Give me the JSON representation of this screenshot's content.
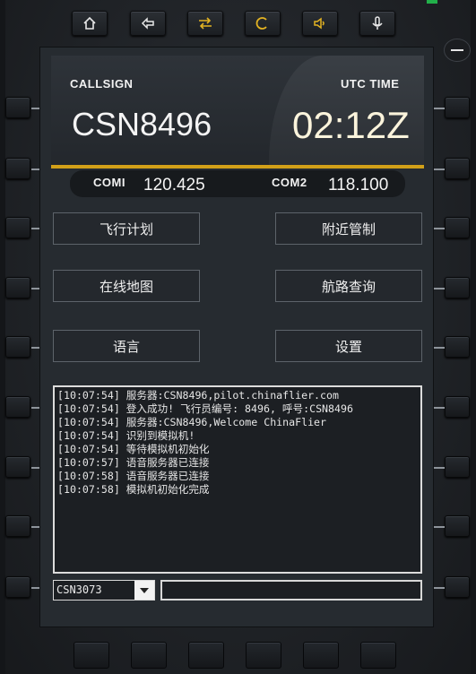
{
  "colors": {
    "accent_gold": "#d2a018",
    "status_green": "#22b04a"
  },
  "toolbar": {
    "keys": [
      {
        "name": "home-key",
        "icon": "home-icon"
      },
      {
        "name": "back-key",
        "icon": "back-arrow-icon"
      },
      {
        "name": "swap-key",
        "icon": "swap-arrows-icon"
      },
      {
        "name": "c-key",
        "icon": "c-icon"
      },
      {
        "name": "speaker-key",
        "icon": "speaker-icon"
      },
      {
        "name": "mic-key",
        "icon": "microphone-icon"
      }
    ]
  },
  "header": {
    "callsign_label": "CALLSIGN",
    "callsign": "CSN8496",
    "utc_label": "UTC TIME",
    "utc_time": "02:12Z",
    "com1_label": "COMI",
    "com1_freq": "120.425",
    "com2_label": "COM2",
    "com2_freq": "118.100"
  },
  "menu": {
    "flight_plan": "飞行计划",
    "nearby_atc": "附近管制",
    "online_map": "在线地图",
    "route_query": "航路查询",
    "language": "语言",
    "settings": "设置"
  },
  "log": [
    "[10:07:54] 服务器:CSN8496,pilot.chinaflier.com",
    "[10:07:54] 登入成功! 飞行员编号: 8496, 呼号:CSN8496",
    "[10:07:54] 服务器:CSN8496,Welcome ChinaFlier",
    "[10:07:54] 识别到模拟机!",
    "[10:07:54] 等待模拟机初始化",
    "[10:07:57] 语音服务器已连接",
    "[10:07:58] 语音服务器已连接",
    "[10:07:58] 模拟机初始化完成"
  ],
  "footer": {
    "callsign_select": "CSN3073",
    "message_input": ""
  }
}
